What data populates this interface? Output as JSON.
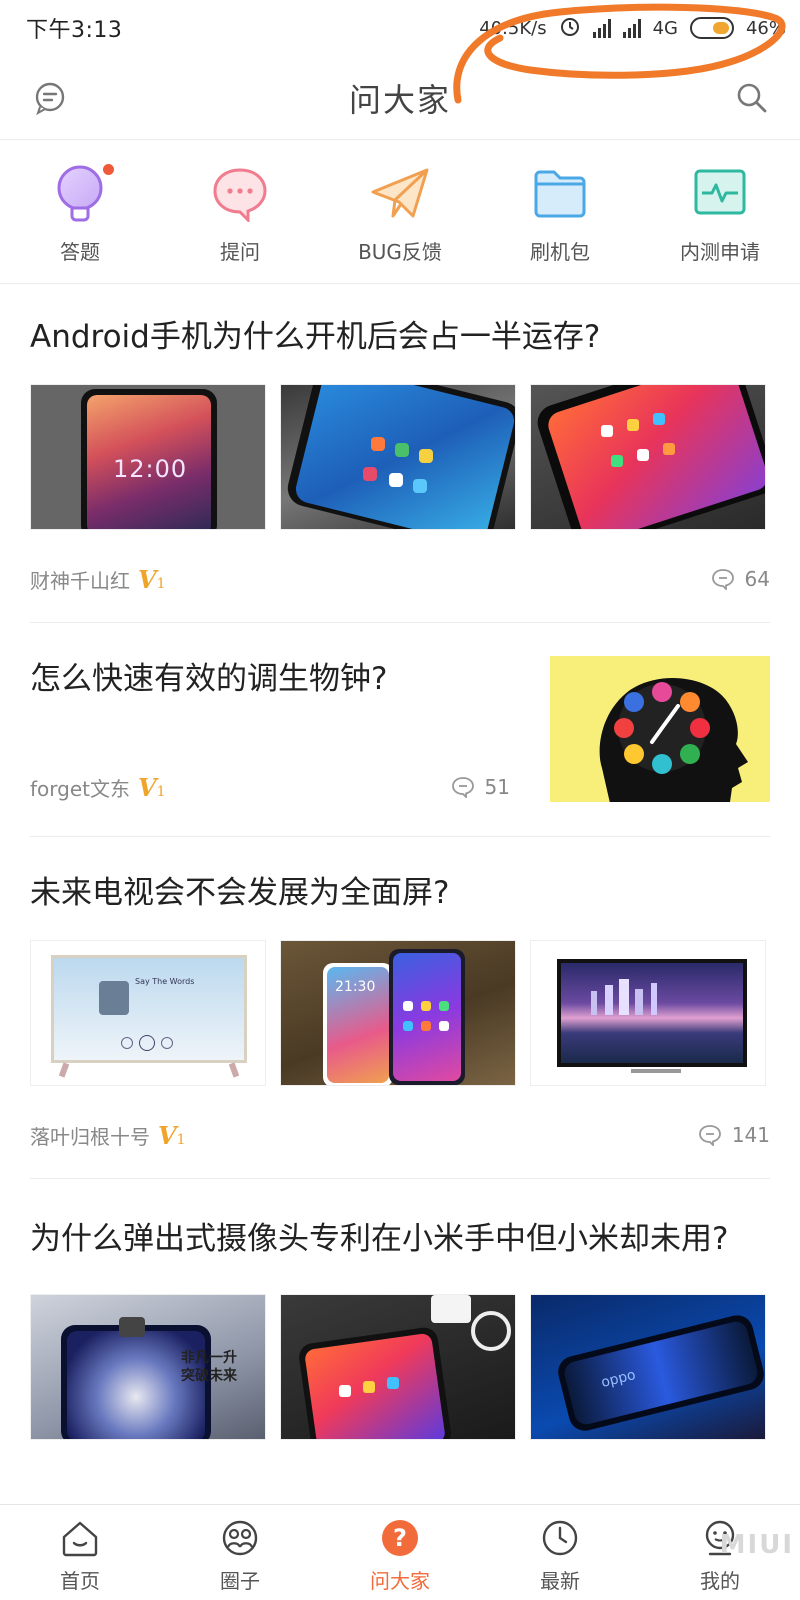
{
  "status": {
    "time": "下午3:13",
    "speed": "40.5K/s",
    "network": "4G",
    "battery": "46%"
  },
  "header": {
    "title": "问大家"
  },
  "categories": [
    {
      "label": "答题",
      "icon": "lightbulb-icon",
      "color": "#a575e6",
      "badge": true
    },
    {
      "label": "提问",
      "icon": "chat-bubble-icon",
      "color": "#f07c8e"
    },
    {
      "label": "BUG反馈",
      "icon": "paper-plane-icon",
      "color": "#f0a050"
    },
    {
      "label": "刷机包",
      "icon": "folder-icon",
      "color": "#4aa8e6"
    },
    {
      "label": "内测申请",
      "icon": "pulse-monitor-icon",
      "color": "#2fb8a0"
    }
  ],
  "posts": [
    {
      "title": "Android手机为什么开机后会占一半运存?",
      "author": "财神千山红",
      "level": "V",
      "level_num": "1",
      "comments": "64"
    },
    {
      "title": "怎么快速有效的调生物钟?",
      "author": "forget文东",
      "level": "V",
      "level_num": "1",
      "comments": "51"
    },
    {
      "title": "未来电视会不会发展为全面屏?",
      "author": "落叶归根十号",
      "level": "V",
      "level_num": "1",
      "comments": "141"
    },
    {
      "title": "为什么弹出式摄像头专利在小米手中但小米却未用?"
    }
  ],
  "thumb_text": {
    "clock": "12:00",
    "tv_caption": "Say The Words",
    "phone_time": "21:30",
    "promo_line1": "非凡一升",
    "promo_line2": "突破未来",
    "oppo": "oppo"
  },
  "nav": [
    {
      "label": "首页",
      "icon": "home-icon"
    },
    {
      "label": "圈子",
      "icon": "community-icon"
    },
    {
      "label": "问大家",
      "icon": "question-icon",
      "active": true
    },
    {
      "label": "最新",
      "icon": "clock-icon"
    },
    {
      "label": "我的",
      "icon": "profile-icon"
    }
  ],
  "watermark": "MIUI",
  "colors": {
    "accent": "#f26b3a",
    "vip": "#f0a52a",
    "scribble": "#f07a2a"
  }
}
